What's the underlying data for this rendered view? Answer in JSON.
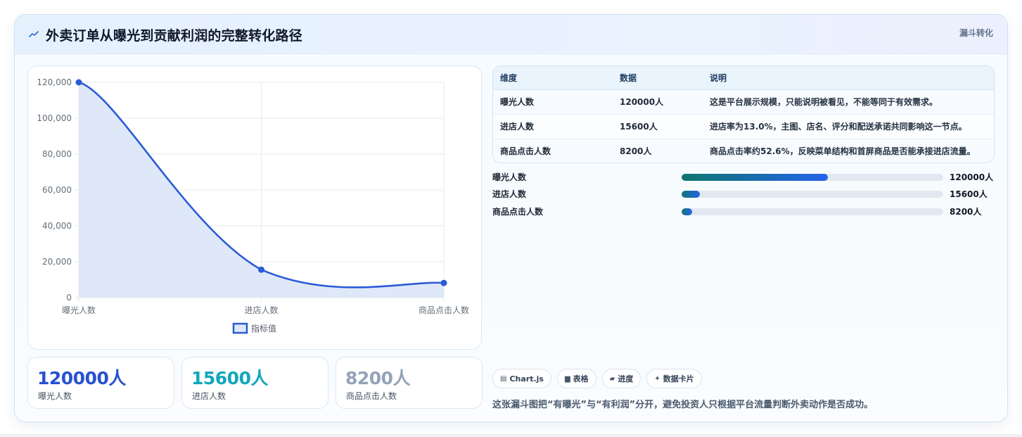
{
  "header": {
    "title": "外卖订单从曝光到贡献利润的完整转化路径",
    "tag": "漏斗转化",
    "title_icon": "trend-line-icon"
  },
  "chart_data": {
    "type": "line",
    "categories": [
      "曝光人数",
      "进店人数",
      "商品点击人数"
    ],
    "series": [
      {
        "name": "指标值",
        "values": [
          120000,
          15600,
          8200
        ],
        "color": "#2a5bd7",
        "fill": "#dfe8f8"
      }
    ],
    "y_ticks": [
      "0",
      "20,000",
      "40,000",
      "60,000",
      "80,000",
      "100,000",
      "120,000"
    ],
    "ylim": [
      0,
      120000
    ],
    "grid": true,
    "legend_position": "bottom",
    "smooth": true
  },
  "kpis": [
    {
      "value": "120000人",
      "label": "曝光人数",
      "color": "#2752d1"
    },
    {
      "value": "15600人",
      "label": "进店人数",
      "color": "#12a7bb"
    },
    {
      "value": "8200人",
      "label": "商品点击人数",
      "color": "#94a3b8"
    }
  ],
  "table": {
    "headers": [
      "维度",
      "数据",
      "说明"
    ],
    "rows": [
      [
        "曝光人数",
        "120000人",
        "这是平台展示规模，只能说明被看见，不能等同于有效需求。"
      ],
      [
        "进店人数",
        "15600人",
        "进店率为13.0%，主图、店名、评分和配送承诺共同影响这一节点。"
      ],
      [
        "商品点击人数",
        "8200人",
        "商品点击率约52.6%，反映菜单结构和首屏商品是否能承接进店流量。"
      ]
    ]
  },
  "progress": [
    {
      "label": "曝光人数",
      "value": "120000人",
      "fraction": 0.56
    },
    {
      "label": "进店人数",
      "value": "15600人",
      "fraction": 0.07
    },
    {
      "label": "商品点击人数",
      "value": "8200人",
      "fraction": 0.04
    }
  ],
  "chips": [
    {
      "icon": "chart-icon",
      "glyph": "▤",
      "label": "Chart.js"
    },
    {
      "icon": "table-icon",
      "glyph": "▆",
      "label": "表格"
    },
    {
      "icon": "progress-icon",
      "glyph": "▰",
      "label": "进度"
    },
    {
      "icon": "sparkle-icon",
      "glyph": "✦",
      "label": "数据卡片"
    }
  ],
  "caption": "这张漏斗图把“有曝光”与“有利润”分开，避免投资人只根据平台流量判断外卖动作是否成功。"
}
